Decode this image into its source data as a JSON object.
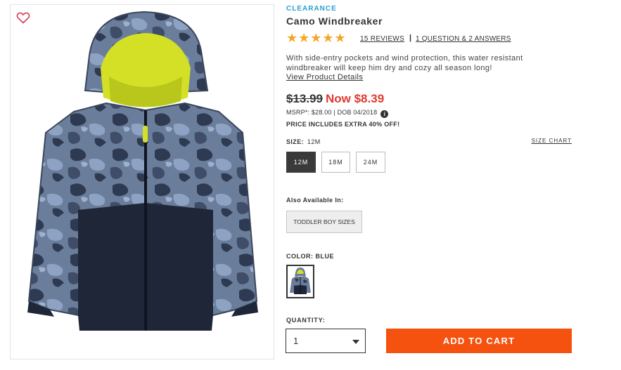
{
  "product": {
    "badge": "CLEARANCE",
    "title": "Camo Windbreaker",
    "stars": "★★★★★",
    "reviews_link": "15 REVIEWS",
    "separator": "|",
    "qa_link": "1 QUESTION & 2 ANSWERS",
    "description": "With side-entry pockets and wind protection, this water resistant windbreaker will keep him dry and cozy all season long!",
    "details_link": "View Product Details",
    "image_alt": "Camo windbreaker jacket with yellow mesh hood lining"
  },
  "pricing": {
    "old_price": "$13.99",
    "now_price": "Now $8.39",
    "msrp": "MSRP*: $28.00 | DOB 04/2018",
    "info_icon": "i",
    "promo": "PRICE INCLUDES EXTRA 40% OFF!"
  },
  "size": {
    "label": "SIZE:",
    "selected": "12M",
    "chart_link": "SIZE CHART",
    "options": [
      {
        "label": "12M",
        "selected": true
      },
      {
        "label": "18M",
        "selected": false
      },
      {
        "label": "24M",
        "selected": false
      }
    ]
  },
  "also_available": {
    "label": "Also Available In:",
    "button": "TODDLER BOY SIZES"
  },
  "color": {
    "label": "COLOR:",
    "value": "BLUE"
  },
  "quantity": {
    "label": "QUANTITY:",
    "value": "1"
  },
  "cart": {
    "button": "ADD TO CART"
  },
  "colors": {
    "accent_blue": "#2a9fd0",
    "sale_red": "#e03a2f",
    "star_gold": "#f5a623",
    "cart_orange": "#f5520f",
    "selected_size": "#3a3a3a"
  },
  "icons": {
    "wishlist": "heart-outline-icon",
    "info": "info-icon",
    "dropdown": "chevron-down-icon"
  }
}
